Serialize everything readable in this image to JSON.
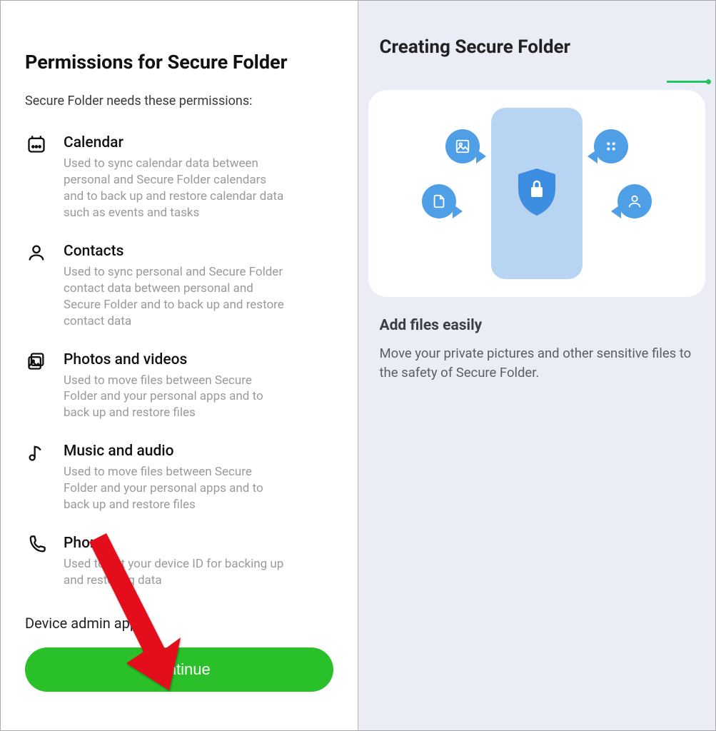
{
  "left": {
    "title": "Permissions for Secure Folder",
    "intro": "Secure Folder needs these permissions:",
    "permissions": [
      {
        "icon": "calendar-icon",
        "title": "Calendar",
        "desc": "Used to sync calendar data between personal and Secure Folder calendars and to back up and restore calendar data such as events and tasks"
      },
      {
        "icon": "contacts-icon",
        "title": "Contacts",
        "desc": "Used to sync personal and Secure Folder contact data between personal and Secure Folder and to back up and restore contact data"
      },
      {
        "icon": "photos-icon",
        "title": "Photos and videos",
        "desc": "Used to move files between Secure Folder and your personal apps and to back up and restore files"
      },
      {
        "icon": "music-icon",
        "title": "Music and audio",
        "desc": "Used to move files between Secure Folder and your personal apps and to back up and restore files"
      },
      {
        "icon": "phone-icon",
        "title": "Phone",
        "desc": "Used to get your device ID for backing up and restoring data"
      }
    ],
    "secondary": "Device admin app",
    "continue": "Continue"
  },
  "right": {
    "title": "Creating Secure Folder",
    "info_title": "Add files easily",
    "info_desc": "Move your private pictures and other sensitive files to the safety of Secure Folder.",
    "progress_percent": 8
  }
}
